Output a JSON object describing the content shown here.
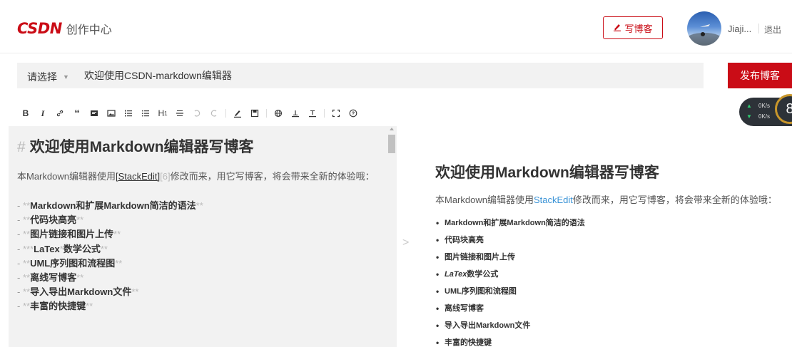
{
  "header": {
    "logo_mark": "CSDN",
    "logo_sub": "创作中心",
    "write_label": "写博客",
    "username": "Jiaji...",
    "logout": "退出"
  },
  "titlebar": {
    "category": "请选择",
    "title_value": "欢迎使用CSDN-markdown编辑器",
    "publish_label": "发布博客"
  },
  "toolbar": {
    "buttons": [
      "B",
      "I",
      "link",
      "quote",
      "code",
      "image",
      "ordered-list",
      "unordered-list",
      "H1",
      "hr",
      "undo",
      "redo",
      "pen",
      "save",
      "globe",
      "upload",
      "download",
      "fullscreen",
      "help"
    ]
  },
  "speed_widget": {
    "up": "0K/s",
    "down": "0K/s",
    "number": "8"
  },
  "editor": {
    "heading_mark": "#",
    "heading": "欢迎使用Markdown编辑器写博客",
    "para_1": "本Markdown编辑器使用",
    "para_link": "[StackEdit]",
    "para_ref": "[6]",
    "para_2": "修改而来，用它写博客，将会带来全新的体验哦：",
    "list": [
      "Markdown和扩展Markdown简洁的语法",
      "代码块高亮",
      "图片链接和图片上传",
      "LaTex",
      "UML序列图和流程图",
      "离线写博客",
      "导入导出Markdown文件",
      "丰富的快捷键"
    ],
    "latex_suffix": "数学公式"
  },
  "preview": {
    "heading": "欢迎使用Markdown编辑器写博客",
    "para_1": "本Markdown编辑器使用",
    "para_link": "StackEdit",
    "para_2": "修改而来，用它写博客，将会带来全新的体验哦：",
    "list": [
      "Markdown和扩展Markdown简洁的语法",
      "代码块高亮",
      "图片链接和图片上传",
      "LaTex",
      "UML序列图和流程图",
      "离线写博客",
      "导入导出Markdown文件",
      "丰富的快捷键"
    ],
    "latex_suffix": "数学公式"
  },
  "colors": {
    "brand_red": "#ca0c16",
    "link_blue": "#3a93d6",
    "editor_bg": "#f2f2f2"
  }
}
